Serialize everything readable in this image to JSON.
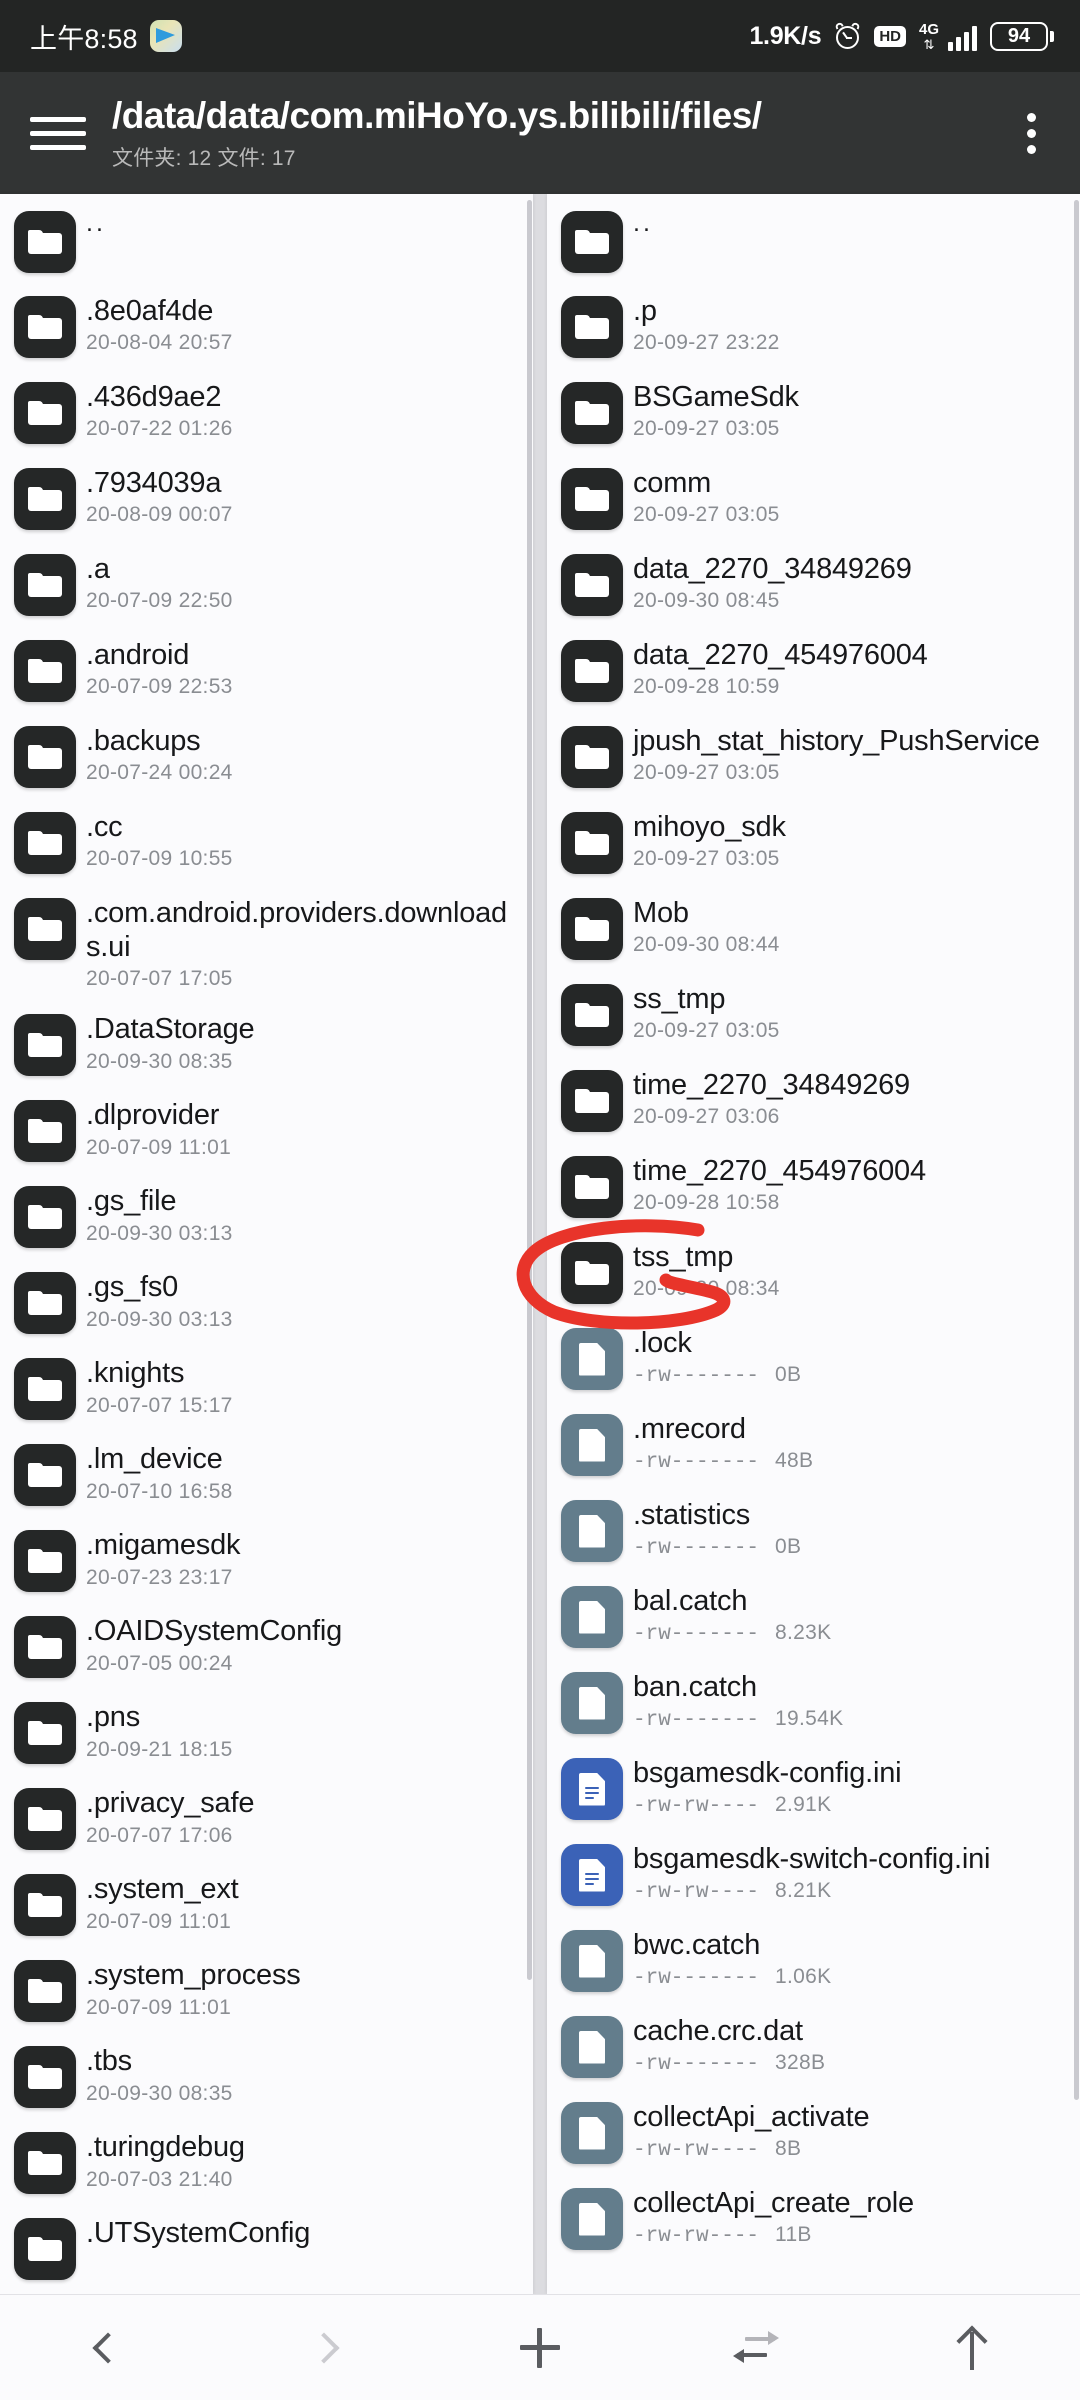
{
  "statusbar": {
    "time": "上午8:58",
    "app_icon": "telegram-icon",
    "net_speed": "1.9K/s",
    "alarm_icon": "alarm-clock-icon",
    "hd_label": "HD",
    "network_type": "4G",
    "battery_level": "94"
  },
  "appbar": {
    "menu_icon": "hamburger-menu-icon",
    "path": "/data/data/com.miHoYo.ys.bilibili/files/",
    "counts": "文件夹: 12  文件: 17",
    "overflow_icon": "kebab-menu-icon"
  },
  "annotation": {
    "color": "#e8342a",
    "target": "tss_tmp"
  },
  "left_pane": {
    "name": "left-file-pane",
    "items": [
      {
        "name": "..",
        "type": "folder",
        "date": ""
      },
      {
        "name": ".8e0af4de",
        "type": "folder",
        "date": "20-08-04 20:57"
      },
      {
        "name": ".436d9ae2",
        "type": "folder",
        "date": "20-07-22 01:26"
      },
      {
        "name": ".7934039a",
        "type": "folder",
        "date": "20-08-09 00:07"
      },
      {
        "name": ".a",
        "type": "folder",
        "date": "20-07-09 22:50"
      },
      {
        "name": ".android",
        "type": "folder",
        "date": "20-07-09 22:53"
      },
      {
        "name": ".backups",
        "type": "folder",
        "date": "20-07-24 00:24"
      },
      {
        "name": ".cc",
        "type": "folder",
        "date": "20-07-09 10:55"
      },
      {
        "name": ".com.android.providers.downloads.ui",
        "type": "folder",
        "date": "20-07-07 17:05"
      },
      {
        "name": ".DataStorage",
        "type": "folder",
        "date": "20-09-30 08:35"
      },
      {
        "name": ".dlprovider",
        "type": "folder",
        "date": "20-07-09 11:01"
      },
      {
        "name": ".gs_file",
        "type": "folder",
        "date": "20-09-30 03:13"
      },
      {
        "name": ".gs_fs0",
        "type": "folder",
        "date": "20-09-30 03:13"
      },
      {
        "name": ".knights",
        "type": "folder",
        "date": "20-07-07 15:17"
      },
      {
        "name": ".lm_device",
        "type": "folder",
        "date": "20-07-10 16:58"
      },
      {
        "name": ".migamesdk",
        "type": "folder",
        "date": "20-07-23 23:17"
      },
      {
        "name": ".OAIDSystemConfig",
        "type": "folder",
        "date": "20-07-05 00:24"
      },
      {
        "name": ".pns",
        "type": "folder",
        "date": "20-09-21 18:15"
      },
      {
        "name": ".privacy_safe",
        "type": "folder",
        "date": "20-07-07 17:06"
      },
      {
        "name": ".system_ext",
        "type": "folder",
        "date": "20-07-09 11:01"
      },
      {
        "name": ".system_process",
        "type": "folder",
        "date": "20-07-09 11:01"
      },
      {
        "name": ".tbs",
        "type": "folder",
        "date": "20-09-30 08:35"
      },
      {
        "name": ".turingdebug",
        "type": "folder",
        "date": "20-07-03 21:40"
      },
      {
        "name": ".UTSystemConfig",
        "type": "folder",
        "date": ""
      }
    ]
  },
  "right_pane": {
    "name": "right-file-pane",
    "items": [
      {
        "name": "..",
        "type": "folder",
        "date": ""
      },
      {
        "name": ".p",
        "type": "folder",
        "date": "20-09-27 23:22"
      },
      {
        "name": "BSGameSdk",
        "type": "folder",
        "date": "20-09-27 03:05"
      },
      {
        "name": "comm",
        "type": "folder",
        "date": "20-09-27 03:05"
      },
      {
        "name": "data_2270_34849269",
        "type": "folder",
        "date": "20-09-30 08:45"
      },
      {
        "name": "data_2270_454976004",
        "type": "folder",
        "date": "20-09-28 10:59"
      },
      {
        "name": "jpush_stat_history_PushService",
        "type": "folder",
        "date": "20-09-27 03:05"
      },
      {
        "name": "mihoyo_sdk",
        "type": "folder",
        "date": "20-09-27 03:05"
      },
      {
        "name": "Mob",
        "type": "folder",
        "date": "20-09-30 08:44"
      },
      {
        "name": "ss_tmp",
        "type": "folder",
        "date": "20-09-27 03:05"
      },
      {
        "name": "time_2270_34849269",
        "type": "folder",
        "date": "20-09-27 03:06"
      },
      {
        "name": "time_2270_454976004",
        "type": "folder",
        "date": "20-09-28 10:58"
      },
      {
        "name": "tss_tmp",
        "type": "folder",
        "date": "20-09-30 08:34"
      },
      {
        "name": ".lock",
        "type": "file",
        "perm": "-rw-------",
        "size": "0B"
      },
      {
        "name": ".mrecord",
        "type": "file",
        "perm": "-rw-------",
        "size": "48B"
      },
      {
        "name": ".statistics",
        "type": "file",
        "perm": "-rw-------",
        "size": "0B"
      },
      {
        "name": "bal.catch",
        "type": "file",
        "perm": "-rw-------",
        "size": "8.23K"
      },
      {
        "name": "ban.catch",
        "type": "file",
        "perm": "-rw-------",
        "size": "19.54K"
      },
      {
        "name": "bsgamesdk-config.ini",
        "type": "ini",
        "perm": "-rw-rw----",
        "size": "2.91K"
      },
      {
        "name": "bsgamesdk-switch-config.ini",
        "type": "ini",
        "perm": "-rw-rw----",
        "size": "8.21K"
      },
      {
        "name": "bwc.catch",
        "type": "file",
        "perm": "-rw-------",
        "size": "1.06K"
      },
      {
        "name": "cache.crc.dat",
        "type": "file",
        "perm": "-rw-------",
        "size": "328B"
      },
      {
        "name": "collectApi_activate",
        "type": "file",
        "perm": "-rw-rw----",
        "size": "8B"
      },
      {
        "name": "collectApi_create_role",
        "type": "file",
        "perm": "-rw-rw----",
        "size": "11B"
      }
    ]
  },
  "bottombar": {
    "items": [
      {
        "icon": "chevron-left-icon",
        "label": "back",
        "enabled": true
      },
      {
        "icon": "chevron-right-icon",
        "label": "forward",
        "enabled": false
      },
      {
        "icon": "plus-icon",
        "label": "new",
        "enabled": true
      },
      {
        "icon": "swap-arrows-icon",
        "label": "switch",
        "enabled": true
      },
      {
        "icon": "arrow-up-icon",
        "label": "parent",
        "enabled": true
      }
    ]
  }
}
